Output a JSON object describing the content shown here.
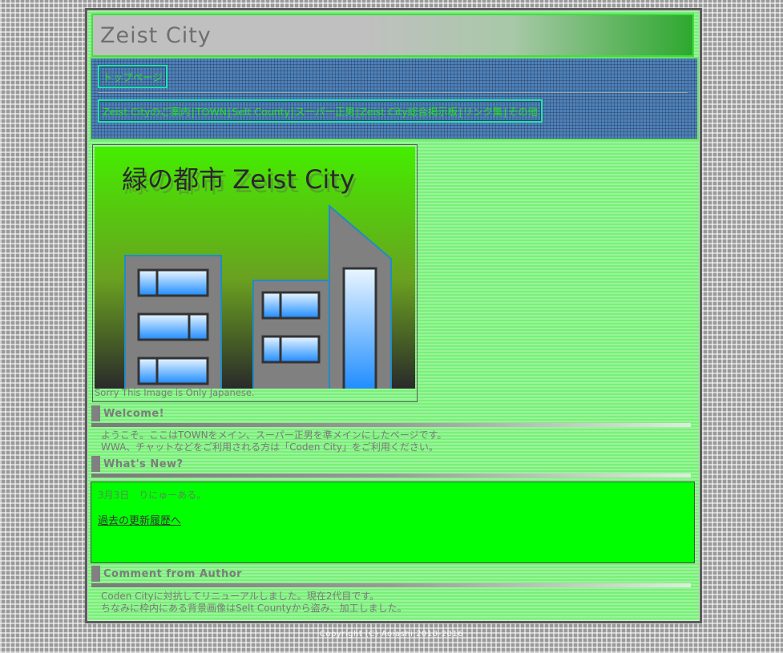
{
  "site": {
    "title": "Zeist City"
  },
  "nav": {
    "top_page": "トップページ",
    "menu": [
      "Zeist Cityのご案内",
      "TOWN",
      "Selt County",
      "スーパー正男",
      "Zeist City総合掲示板",
      "リンク集",
      "その他"
    ],
    "separator": "|"
  },
  "hero": {
    "heading": "緑の都市 Zeist City",
    "caption": "Sorry This Image is Only Japanese."
  },
  "welcome": {
    "title": "Welcome!",
    "lines": [
      "ようこそ。ここはTOWNをメイン、スーパー正男を準メインにしたページです。",
      "WWA、チャットなどをご利用される方は「Coden City」をご利用ください。"
    ]
  },
  "whats_new": {
    "title": "What's New?",
    "entry": "3月3日　りにゅーある。",
    "history_link": "過去の更新履歴へ"
  },
  "author": {
    "title": "Comment from Author",
    "lines": [
      "Coden Cityに対抗してリニューアルしました。現在2代目です。",
      "ちなみに枠内にある背景画像はSelt Countyから盗み、加工しました。"
    ]
  },
  "footer": {
    "copyright": "Copyright (C) Aoiashi 2010-2016"
  },
  "colors": {
    "accent_green": "#00ff00",
    "nav_blue": "#4e82ba",
    "link_green": "#20e020"
  }
}
